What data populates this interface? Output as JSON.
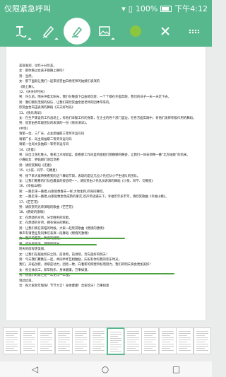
{
  "status": {
    "carrier": "仅限紧急呼叫",
    "battery_pct": "100%",
    "time": "下午4:12"
  },
  "toolbar": {
    "tools": [
      "text-tool",
      "pen-tool",
      "highlighter-tool",
      "image-tool",
      "color-swatch",
      "close-tool",
      "more-tool"
    ],
    "accent_color": "#57b88e",
    "swatch_color": "#8cc63f"
  },
  "document": {
    "lines": [
      "美容滋润、动作十分优美。",
      "女：那你看过女孩子跳舞上舞吗？",
      "男：当然。",
      "女：那下面就让我们一起来欣赏由白杨老师的姑娘们表演的",
      "《跳上舞》。",
      "12、《天天好时光》",
      "男：许久前，晴天冲着太阳光，我们在晚霞下自由地玩耍；一个个都在外面奔跑，我们的日子一天一天走下去，",
      "男：我们拥有无限的快乐，让我们来欣赏由金星老师的团体带来的，",
      "欣赏由金布田表演的舞蹈《天天好时光》",
      "13、《快乐清早》",
      "女：在生产建设的工作战场上，有他们辛勤工作的身影，在企业的各个部门里边，在各方面实践中，有他们发挥积极作用的舞蹈。他们建设着这样一片又一片土地。",
      "男：欣赏由各年级团队的表演的一份《快乐清早》。",
      "(中场)",
      "请第一位、三厂长、占主席抽取三等奖幸运号码",
      "请第厂长、局主席抽取二等奖幸运号码",
      "请第一位局文员抽取一等奖幸运号码",
      "14、《走着》",
      "男：日出江花红胜火，春来江水绿如蓝。能看那工作间里的姐姐们那婀娜的舞姿，让我们一同去领略一番“北方姑娘”的风采。",
      "小舞蹈女：胖姑娘们请出场吧",
      "男：请欣赏舞蹈《走着》",
      "15、《小孩、同学、匀檫星》",
      "男：接下来大家将要看到的这个舞蹈节目，表现的是这几位少先红队小学生组队的团队。",
      "女：让我们看看的们队伍最美的姿态吧~~，请欣赏由少先队员表演的舞蹈《小孩、同学、匀檫星》",
      "16、《幸福山楂》",
      "男：一路走来一路唱,山歌就像春天一样,大地生辉,四海同舞欣。",
      "女：一路走来一路唱,山歌就像金色成熟的果实,欢声笑语满天下，幸福年年多丰年，请欣赏歌曲《幸福山楂》。",
      "17、《芒芒花》",
      "男：请欣赏何光荣演唱的歌曲《芒芒花》",
      "18、《燃烧的激情》",
      "女：在燃烧的岁月，分享胜利的欢歌。",
      "女：在燃烧的岁月，拥有快乐的精彩。",
      "男：让我们将在来临的时候，大家一起欣赏歌曲《燃烧的激情》",
      "事声有请营业及同事们表演一段舞蹈《燃烧的激情》",
      "女：歌声的甜美，舞姿的翩跹，",
      "男：欢乐的海洋，激情的时光。",
      "明天的前程更美丽，",
      "女：让我们在越往明日之际，前进吧，前进吧，奔向美好的明天！",
      "男：今天我们聚集在一起，共同举杯互相勉励，庆祝有你有我的欢乐时光，",
      "我们，开拓创新，进取是动力，团结一致，向着新的辉煌目标而努力，我们的明天将会更加美好！",
      "女：祝全体员工，新年快乐，身体健康，万事如意，",
      "男：祝我们的新世纪一年更比一年强，",
      "到此结束。",
      "合：祝大家新年愉快！节节大吉！身体健康！合家欢乐！万事如意"
    ]
  },
  "thumbnails": {
    "count": 12,
    "selected_index": 6
  }
}
